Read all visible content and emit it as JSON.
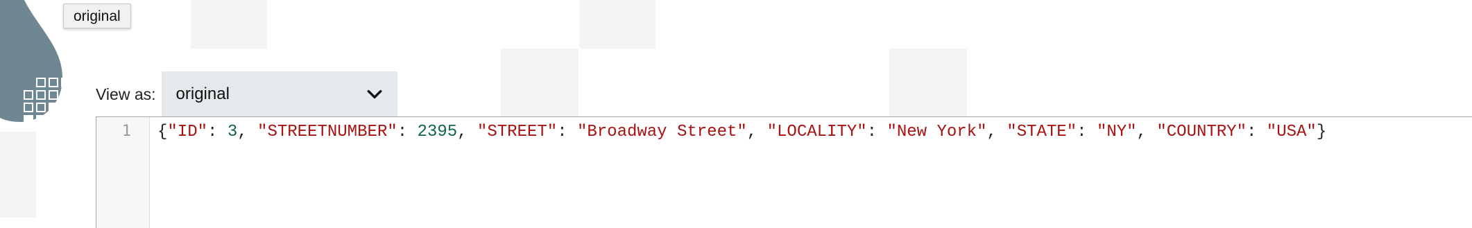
{
  "tooltip": {
    "label": "original"
  },
  "viewer": {
    "label": "View as:",
    "selected": "original"
  },
  "editor": {
    "line_number": "1",
    "tokens": [
      {
        "t": "{",
        "c": "punct"
      },
      {
        "t": "\"ID\"",
        "c": "key"
      },
      {
        "t": ": ",
        "c": "punct"
      },
      {
        "t": "3",
        "c": "num"
      },
      {
        "t": ", ",
        "c": "punct"
      },
      {
        "t": "\"STREETNUMBER\"",
        "c": "key"
      },
      {
        "t": ": ",
        "c": "punct"
      },
      {
        "t": "2395",
        "c": "num"
      },
      {
        "t": ", ",
        "c": "punct"
      },
      {
        "t": "\"STREET\"",
        "c": "key"
      },
      {
        "t": ": ",
        "c": "punct"
      },
      {
        "t": "\"Broadway Street\"",
        "c": "str"
      },
      {
        "t": ", ",
        "c": "punct"
      },
      {
        "t": "\"LOCALITY\"",
        "c": "key"
      },
      {
        "t": ": ",
        "c": "punct"
      },
      {
        "t": "\"New York\"",
        "c": "str"
      },
      {
        "t": ", ",
        "c": "punct"
      },
      {
        "t": "\"STATE\"",
        "c": "key"
      },
      {
        "t": ": ",
        "c": "punct"
      },
      {
        "t": "\"NY\"",
        "c": "str"
      },
      {
        "t": ", ",
        "c": "punct"
      },
      {
        "t": "\"COUNTRY\"",
        "c": "key"
      },
      {
        "t": ": ",
        "c": "punct"
      },
      {
        "t": "\"USA\"",
        "c": "str"
      },
      {
        "t": "}",
        "c": "punct"
      }
    ]
  },
  "icons": {
    "logo": "droplet-logo-icon",
    "select_arrow": "chevron-down-icon"
  },
  "colors": {
    "key": "#aa1111",
    "string": "#aa1111",
    "number": "#116644",
    "select_bg": "#e6e9eb"
  }
}
